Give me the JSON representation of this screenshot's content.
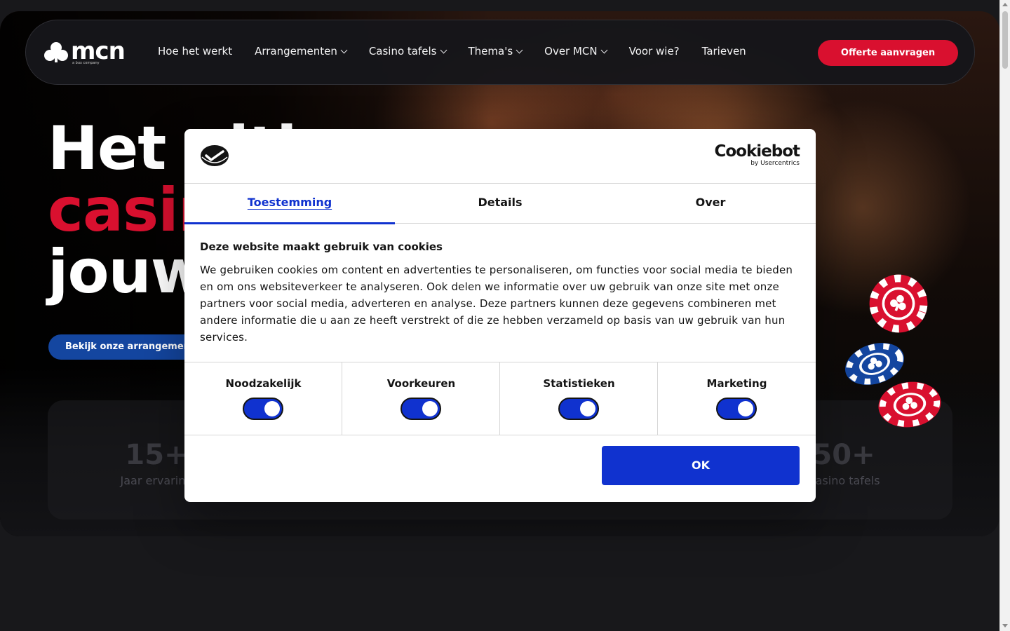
{
  "nav": {
    "logo_text": "mcn",
    "logo_sub": "a bux company",
    "items": [
      {
        "label": "Hoe het werkt"
      },
      {
        "label": "Arrangementen"
      },
      {
        "label": "Casino tafels"
      },
      {
        "label": "Thema's"
      },
      {
        "label": "Over MCN"
      },
      {
        "label": "Voor wie?"
      },
      {
        "label": "Tarieven"
      }
    ],
    "cta": "Offerte aanvragen"
  },
  "hero": {
    "title_line1": "Het ultieme",
    "title_line2": "casino",
    "title_line3": "jouw",
    "cta": "Bekijk onze arrangementen",
    "stats": [
      {
        "num": "15+",
        "label": "Jaar ervaring"
      },
      {
        "num": "50+",
        "label": "Casino tafels"
      }
    ]
  },
  "cookie_dialog": {
    "brand": "Cookiebot",
    "brand_sub": "by Usercentrics",
    "tabs": [
      {
        "label": "Toestemming",
        "active": true
      },
      {
        "label": "Details",
        "active": false
      },
      {
        "label": "Over",
        "active": false
      }
    ],
    "heading": "Deze website maakt gebruik van cookies",
    "text": "We gebruiken cookies om content en advertenties te personaliseren, om functies voor social media te bieden en om ons websiteverkeer te analyseren. Ook delen we informatie over uw gebruik van onze site met onze partners voor social media, adverteren en analyse. Deze partners kunnen deze gegevens combineren met andere informatie die u aan ze heeft verstrekt of die ze hebben verzameld op basis van uw gebruik van hun services.",
    "toggles": [
      {
        "label": "Noodzakelijk",
        "on": true
      },
      {
        "label": "Voorkeuren",
        "on": true
      },
      {
        "label": "Statistieken",
        "on": true
      },
      {
        "label": "Marketing",
        "on": true
      }
    ],
    "ok": "OK"
  },
  "colors": {
    "brand_red": "#d9102f",
    "cookiebot_blue": "#1032cf",
    "hero_cta_blue": "#1446a0"
  }
}
